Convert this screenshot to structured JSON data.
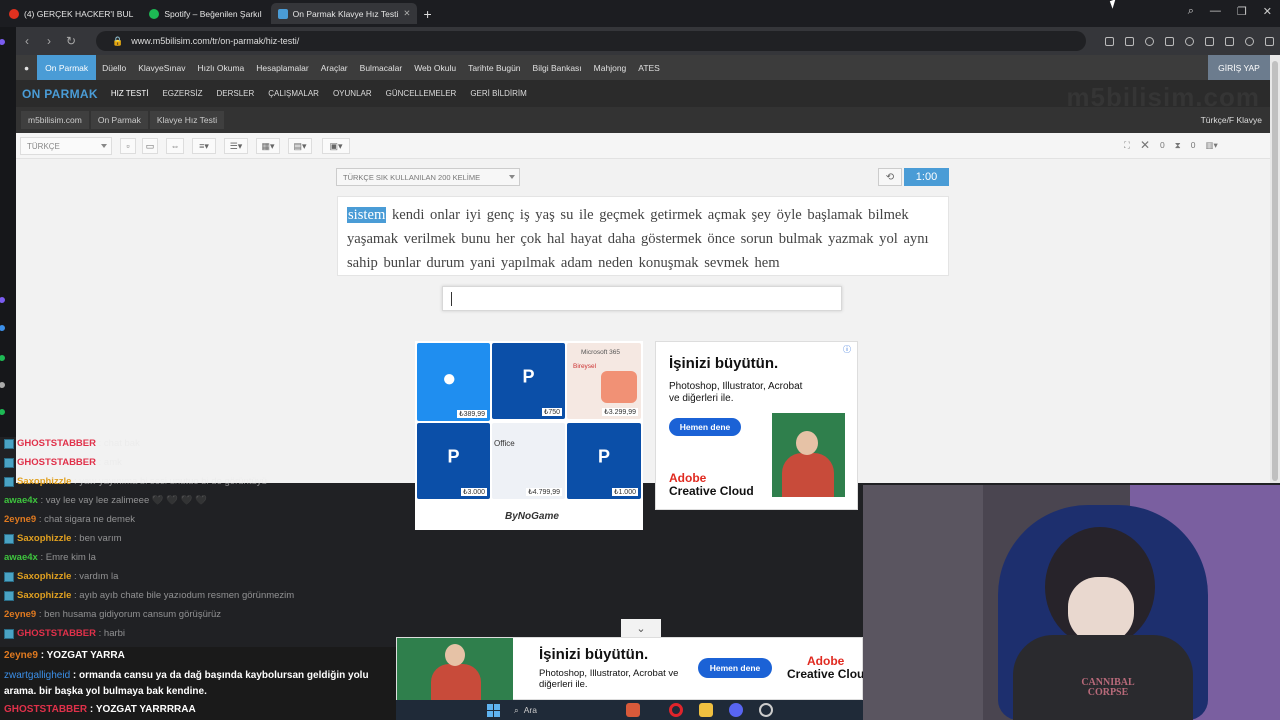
{
  "browser": {
    "tabs": [
      {
        "label": "(4) GERÇEK HACKER'I BUL",
        "color": "#e0311f"
      },
      {
        "label": "Spotify – Beğenilen Şarkıl",
        "color": "#1db954"
      },
      {
        "label": "On Parmak Klavye Hız Testi",
        "color": "#4a9cd6"
      }
    ],
    "new_tab": "+",
    "url": "www.m5bilisim.com/tr/on-parmak/hiz-testi/"
  },
  "site": {
    "menu": [
      "On Parmak",
      "Düello",
      "KlavyeSınav",
      "Hızlı Okuma",
      "Hesaplamalar",
      "Araçlar",
      "Bulmacalar",
      "Web Okulu",
      "Tarihte Bugün",
      "Bilgi Bankası",
      "Mahjong",
      "ATES"
    ],
    "login": "GİRİŞ YAP",
    "brand": "ON PARMAK",
    "submenu": [
      "HIZ TESTİ",
      "EGZERSİZ",
      "DERSLER",
      "ÇALIŞMALAR",
      "OYUNLAR",
      "GÜNCELLEMELER",
      "GERİ BİLDİRİM"
    ],
    "watermark": "m5bilisim.com",
    "breadcrumbs": [
      "m5bilisim.com",
      "On Parmak",
      "Klavye Hız Testi"
    ],
    "keyboard_layout": "Türkçe/F Klavye"
  },
  "test": {
    "language": "TÜRKÇE",
    "word_set": "TÜRKÇE SIK KULLANILAN 200 KELİME",
    "errors": "0",
    "time_count": "0",
    "timer": "1:00",
    "current_word": "sistem",
    "words_rest": "kendi onlar iyi genç iş yaş su ile geçmek getirmek açmak şey öyle başlamak bilmek yaşamak verilmek bunu her çok hal hayat daha göstermek önce sorun bulmak yazmak yol aynı sahip bunlar durum yani yapılmak adam neden konuşmak sevmek hem",
    "input_value": ""
  },
  "ad1": {
    "prices": [
      "₺389,99",
      "₺750",
      "₺3.299,99",
      "₺3.000",
      "₺4.799,99",
      "₺1.000"
    ],
    "office_label": "Office",
    "ms365_label": "Microsoft 365",
    "bireysel": "Bireysel",
    "brand": "ByNoGame"
  },
  "ad2": {
    "headline": "İşinizi büyütün.",
    "body": "Photoshop, Illustrator, Acrobat ve diğerleri ile.",
    "button": "Hemen dene",
    "logo1": "Adobe",
    "logo2": "Creative Cloud"
  },
  "ad3": {
    "headline": "İşinizi büyütün.",
    "body": "Photoshop, Illustrator, Acrobat ve diğerleri ile.",
    "button": "Hemen dene",
    "logo1": "Adobe",
    "logo2": "Creative Clou"
  },
  "chat": [
    {
      "user": "GHOSTSTABBER",
      "color": "#e0314a",
      "msg": "chat bak"
    },
    {
      "user": "GHOSTSTABBER",
      "color": "#e0314a",
      "msg": "amk"
    },
    {
      "user": "Saxophizzle",
      "color": "#e0a020",
      "msg": "yaw yayınıma bi sesi unutuo bi de görüntüyü"
    },
    {
      "user": "awae4x",
      "color": "#3ec43e",
      "msg": "vay lee vay lee zalimeee 🖤 🖤 🖤 🖤"
    },
    {
      "user": "2eyne9",
      "color": "#e07a20",
      "msg": "chat sigara ne demek"
    },
    {
      "user": "Saxophizzle",
      "color": "#e0a020",
      "msg": "ben varım"
    },
    {
      "user": "awae4x",
      "color": "#3ec43e",
      "msg": "Emre kim la"
    },
    {
      "user": "Saxophizzle",
      "color": "#e0a020",
      "msg": "vardım la"
    },
    {
      "user": "Saxophizzle",
      "color": "#e0a020",
      "msg": "ayıb ayıb chate bile yazıodum resmen görünmezim"
    },
    {
      "user": "2eyne9",
      "color": "#e07a20",
      "msg": "ben husama gidiyorum cansum görüşürüz"
    },
    {
      "user": "GHOSTSTABBER",
      "color": "#e0314a",
      "msg": "harbi"
    }
  ],
  "chat_highlight": [
    {
      "user": "2eyne9",
      "color": "#e07a20",
      "msg": "YOZGAT YARRA"
    },
    {
      "user": "zwartgalligheid",
      "color": "#3b8fe8",
      "msg": "ormanda cansu ya da dağ başında kaybolursan geldiğin yolu arama. bir başka yol bulmaya bak kendine."
    },
    {
      "user": "GHOSTSTABBER",
      "color": "#e0314a",
      "msg": "YOZGAT YARRRRAA"
    }
  ],
  "taskbar": {
    "search": "Ara"
  },
  "webcam": {
    "shirt_text": "CANNIBAL CORPSE"
  }
}
